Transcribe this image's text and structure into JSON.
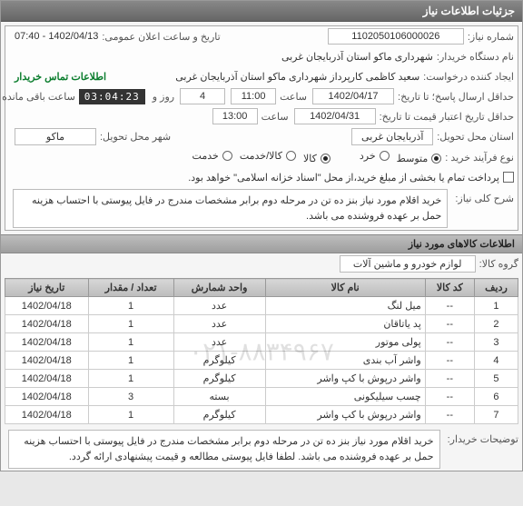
{
  "title_bar": "جزئیات اطلاعات نیاز",
  "need_number_label": "شماره نیاز:",
  "need_number": "1102050106000026",
  "announce_label": "تاریخ و ساعت اعلان عمومی:",
  "announce_value": "1402/04/13 - 07:40",
  "buyer_org_label": "نام دستگاه خریدار:",
  "buyer_org": "شهرداری ماکو استان آذربایجان غربی",
  "requester_label": "ایجاد کننده درخواست:",
  "requester": "سعید کاظمی کارپرداز شهرداری ماکو استان آذربایجان غربی",
  "contact_label": "اطلاعات تماس خریدار",
  "reply_deadline_label": "حداقل ارسال پاسخ؛ تا تاریخ:",
  "reply_date": "1402/04/17",
  "time_label": "ساعت",
  "reply_time": "11:00",
  "days_value": "4",
  "days_label": "روز و",
  "countdown": "03:04:23",
  "remaining_label": "ساعت باقی مانده",
  "price_deadline_label": "حداقل تاریخ اعتبار قیمت تا تاریخ:",
  "price_date": "1402/04/31",
  "price_time": "13:00",
  "province_label": "استان محل تحویل:",
  "province": "آذربایجان غربی",
  "city_label": "شهر محل تحویل:",
  "city": "ماکو",
  "process_type_label": "نوع فرآیند خرید :",
  "process_options": [
    {
      "label": "متوسط",
      "checked": true
    },
    {
      "label": "خرد",
      "checked": false
    }
  ],
  "product_type_label": "",
  "product_options": [
    {
      "label": "کالا",
      "checked": true
    },
    {
      "label": "کالا/خدمت",
      "checked": false
    },
    {
      "label": "خدمت",
      "checked": false
    }
  ],
  "payment_note": "پرداخت تمام یا بخشی از مبلغ خرید،از محل \"اسناد خزانه اسلامی\" خواهد بود.",
  "summary_label": "شرح کلی نیاز:",
  "summary_text": "خرید اقلام مورد نیاز بنز ده تن در مرحله دوم برابر مشخصات مندرج در فایل پیوستی با احتساب هزینه حمل بر عهده فروشنده می باشد.",
  "items_header": "اطلاعات کالاهای مورد نیاز",
  "group_label": "گروه کالا:",
  "group_value": "لوازم خودرو و ماشین آلات",
  "columns": {
    "row": "ردیف",
    "code": "کد کالا",
    "name": "نام کالا",
    "unit": "واحد شمارش",
    "qty": "تعداد / مقدار",
    "date": "تاریخ نیاز"
  },
  "items": [
    {
      "row": 1,
      "code": "--",
      "name": "میل لنگ",
      "unit": "عدد",
      "qty": 1,
      "date": "1402/04/18"
    },
    {
      "row": 2,
      "code": "--",
      "name": "پد یاتاقان",
      "unit": "عدد",
      "qty": 1,
      "date": "1402/04/18"
    },
    {
      "row": 3,
      "code": "--",
      "name": "پولی موتور",
      "unit": "عدد",
      "qty": 1,
      "date": "1402/04/18"
    },
    {
      "row": 4,
      "code": "--",
      "name": "واشر آب بندی",
      "unit": "کیلوگرم",
      "qty": 1,
      "date": "1402/04/18"
    },
    {
      "row": 5,
      "code": "--",
      "name": "واشر درپوش با کپ واشر",
      "unit": "کیلوگرم",
      "qty": 1,
      "date": "1402/04/18"
    },
    {
      "row": 6,
      "code": "--",
      "name": "چسب سیلیکونی",
      "unit": "بسته",
      "qty": 3,
      "date": "1402/04/18"
    },
    {
      "row": 7,
      "code": "--",
      "name": "واشر درپوش با کپ واشر",
      "unit": "کیلوگرم",
      "qty": 1,
      "date": "1402/04/18"
    }
  ],
  "buyer_notes_label": "توضیحات خریدار:",
  "buyer_notes": "خرید اقلام مورد نیاز بنز ده تن در مرحله دوم برابر مشخصات مندرج در فایل پیوستی با احتساب هزینه حمل بر عهده فروشنده می باشد. لطفا فایل پیوستی مطالعه و قیمت پیشنهادی ارائه گردد.",
  "watermark": "۰۲۱-۸۸۳۴۹۶۷"
}
